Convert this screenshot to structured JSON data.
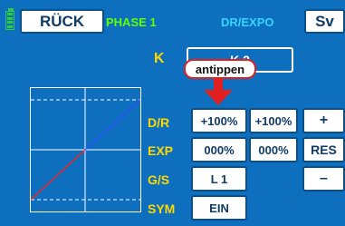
{
  "header": {
    "back_label": "RÜCK",
    "phase_label": "PHASE 1",
    "menu_title": "DR/EXPO",
    "sv_label": "Sv"
  },
  "channel": {
    "label": "K",
    "value": "K 2"
  },
  "callout": {
    "text": "antippen"
  },
  "rows": {
    "dr": {
      "label": "D/R",
      "left": "+100%",
      "right": "+100%"
    },
    "exp": {
      "label": "EXP",
      "left": "000%",
      "right": "000%"
    },
    "gs": {
      "label": "G/S",
      "value": "L 1"
    },
    "sym": {
      "label": "SYM",
      "value": "EIN"
    }
  },
  "side_buttons": {
    "plus": "+",
    "res": "RES",
    "minus": "–"
  },
  "colors": {
    "background": "#0d6fbd",
    "label_yellow": "#ffd800",
    "phase_green": "#62ff00",
    "title_cyan": "#35d6ff",
    "callout_red": "#e02020",
    "curve_blue": "#2a4fff",
    "curve_red": "#ff2020"
  },
  "icons": {
    "battery": "battery-icon",
    "arrow": "arrow-down-icon"
  }
}
